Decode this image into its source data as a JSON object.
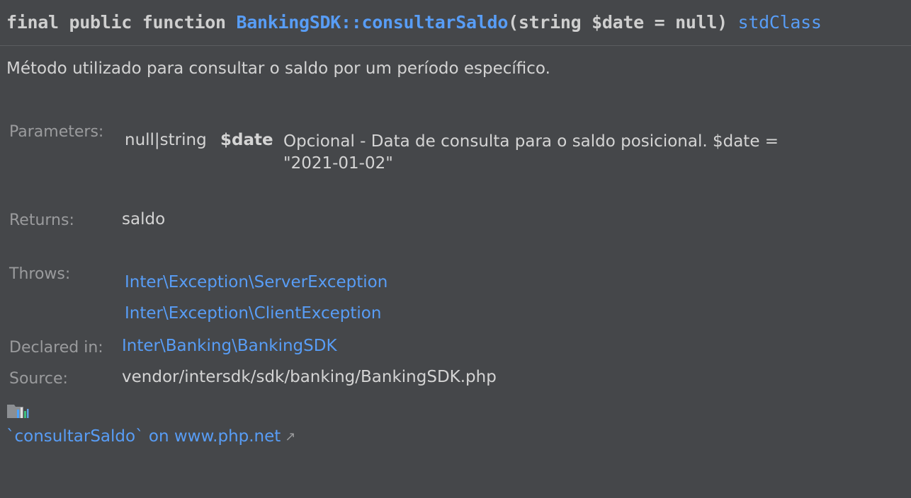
{
  "signature": {
    "prefix": "final public function ",
    "qualified_name": "BankingSDK::consultarSaldo",
    "params": "(string $date = null) ",
    "return_type": "stdClass"
  },
  "description": "Método utilizado para consultar o saldo por um período específico.",
  "parameters": {
    "label": "Parameters:",
    "type": "null|string",
    "name": "$date",
    "description": "Opcional - Data de consulta para o saldo posicional. $date = \"2021-01-02\""
  },
  "returns": {
    "label": "Returns:",
    "value": "saldo"
  },
  "throws": {
    "label": "Throws:",
    "items": [
      "Inter\\Exception\\ServerException",
      "Inter\\Exception\\ClientException"
    ]
  },
  "declared_in": {
    "label": "Declared in:",
    "value": "Inter\\Banking\\BankingSDK"
  },
  "source": {
    "label": "Source:",
    "value": "vendor/intersdk/sdk/banking/BankingSDK.php"
  },
  "footer": {
    "icon": "library-icon",
    "link_text": "`consultarSaldo` on www.php.net",
    "external_icon": "↗"
  },
  "colors": {
    "background": "#45474a",
    "link": "#589df6",
    "text": "#d4d4d4",
    "label": "#9a9b9d"
  }
}
